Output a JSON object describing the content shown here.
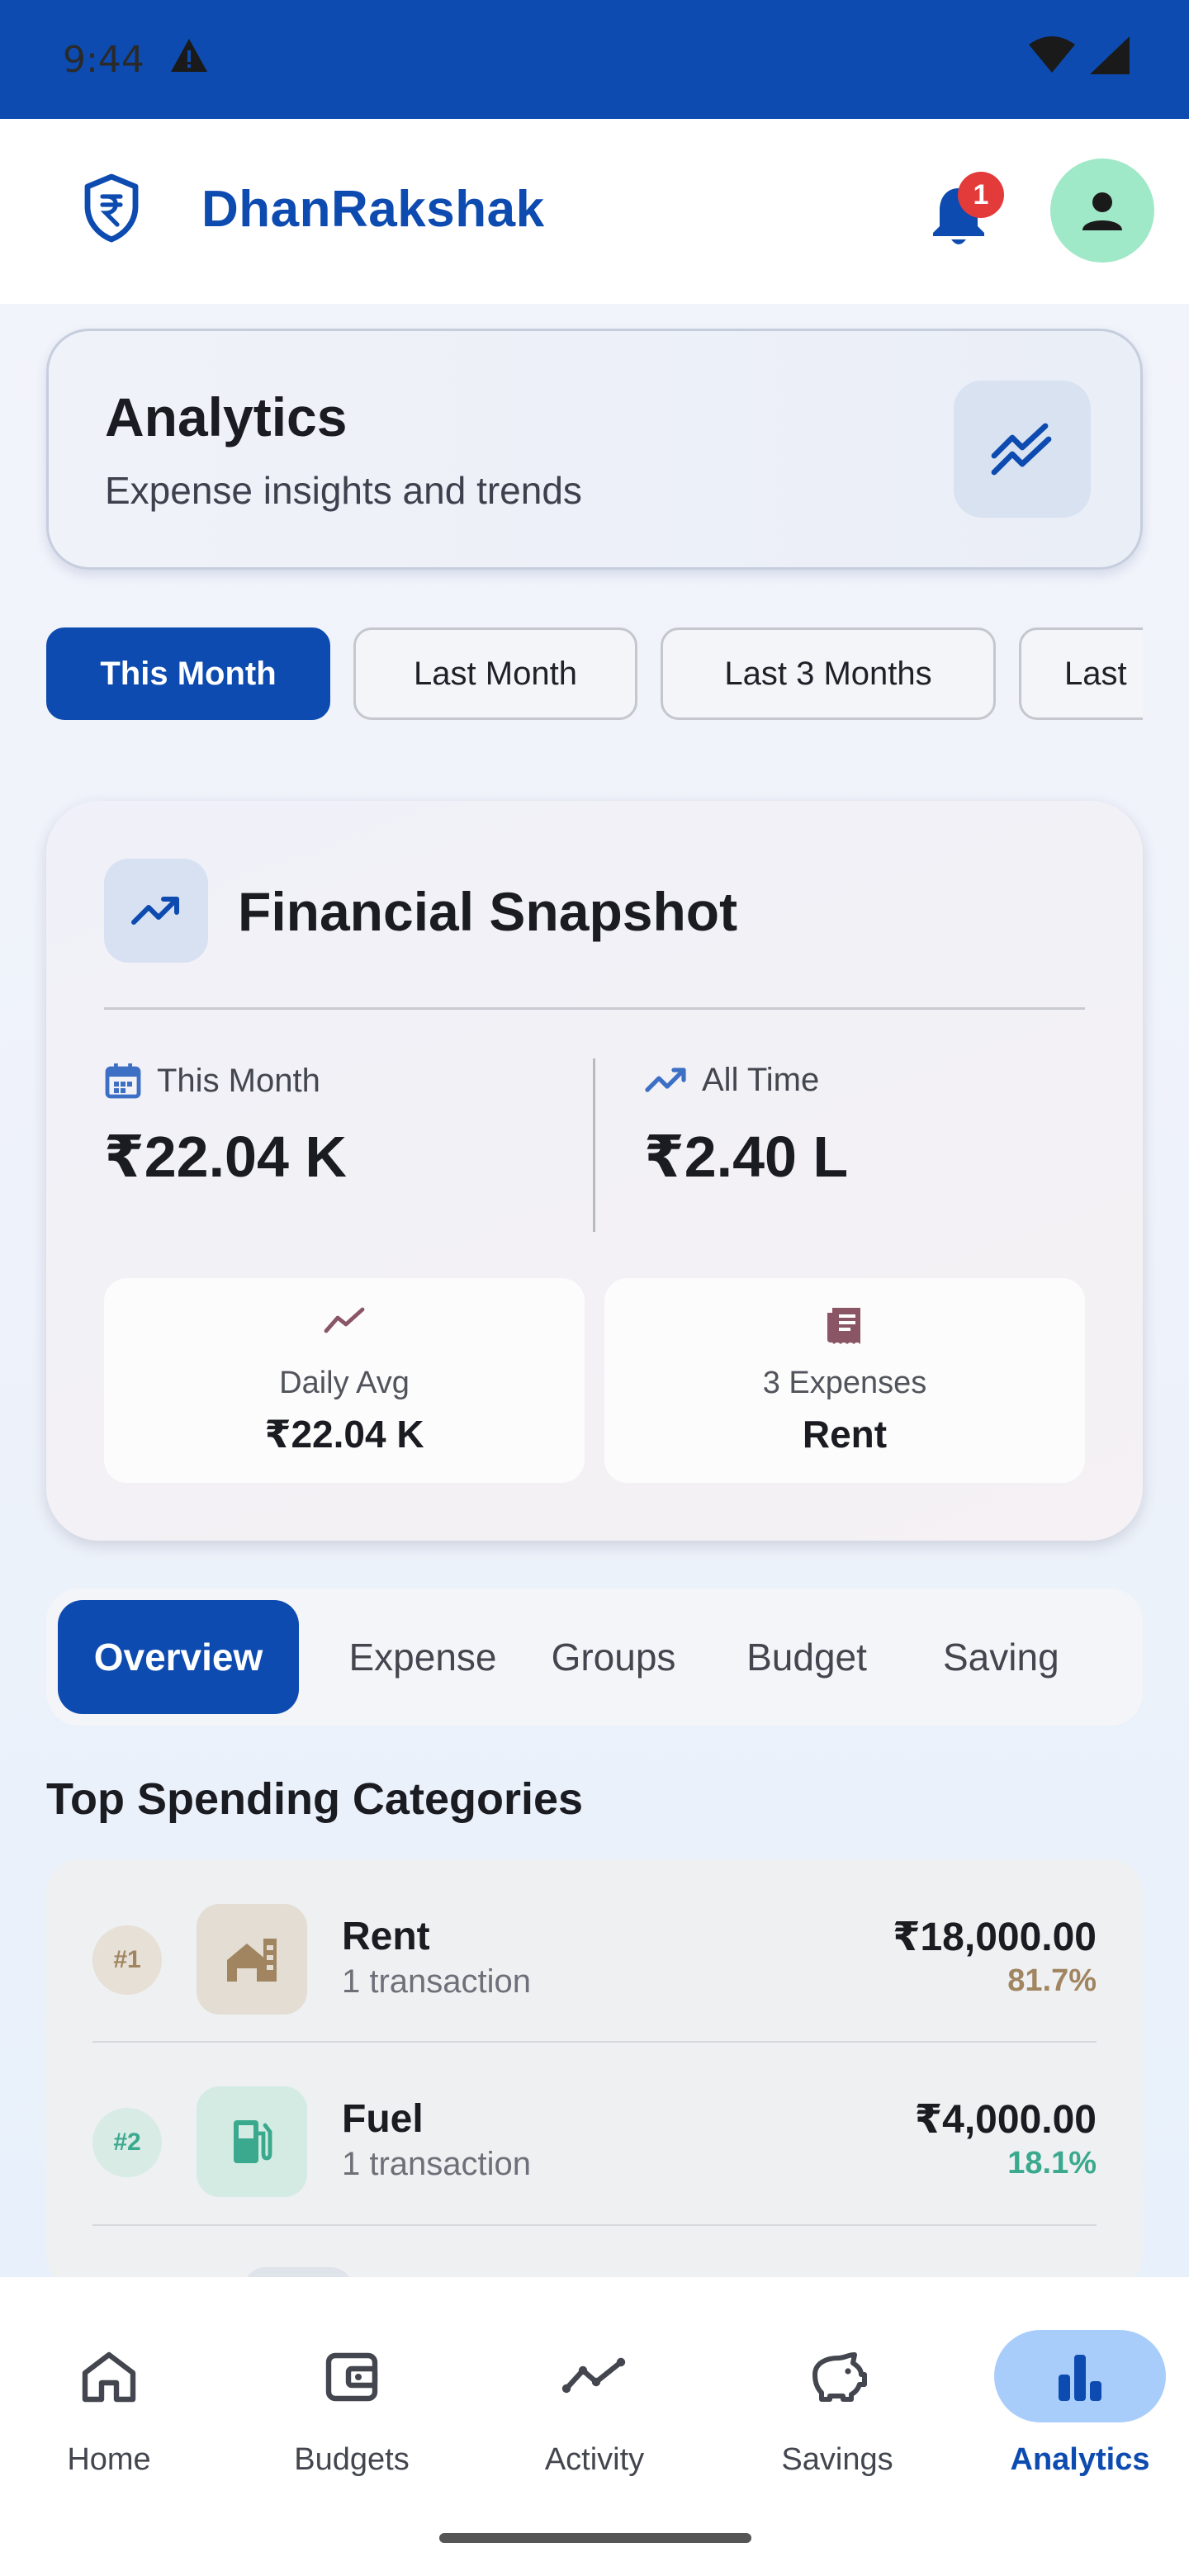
{
  "status_bar": {
    "time": "9:44"
  },
  "app_bar": {
    "title": "DhanRakshak",
    "notification_count": "1"
  },
  "header_card": {
    "title": "Analytics",
    "subtitle": "Expense insights and trends"
  },
  "period_chips": [
    "This Month",
    "Last Month",
    "Last 3 Months",
    "Last"
  ],
  "snapshot": {
    "title": "Financial Snapshot",
    "this_month_label": "This Month",
    "this_month_value": "₹22.04 K",
    "all_time_label": "All Time",
    "all_time_value": "₹2.40 L",
    "daily_avg_label": "Daily Avg",
    "daily_avg_value": "₹22.04 K",
    "expenses_label": "3 Expenses",
    "expenses_value": "Rent"
  },
  "tabs": [
    "Overview",
    "Expense",
    "Groups",
    "Budget",
    "Saving"
  ],
  "top_spending": {
    "title": "Top Spending Categories",
    "items": [
      {
        "rank": "#1",
        "name": "Rent",
        "sub": "1 transaction",
        "amount": "₹18,000.00",
        "pct": "81.7%",
        "color": "#a08560"
      },
      {
        "rank": "#2",
        "name": "Fuel",
        "sub": "1 transaction",
        "amount": "₹4,000.00",
        "pct": "18.1%",
        "color": "#3aa98e"
      }
    ]
  },
  "bottom_nav": [
    "Home",
    "Budgets",
    "Activity",
    "Savings",
    "Analytics"
  ],
  "colors": {
    "primary": "#0d4bb0",
    "badge": "#e33a3a",
    "avatar": "#9fe8c8"
  }
}
